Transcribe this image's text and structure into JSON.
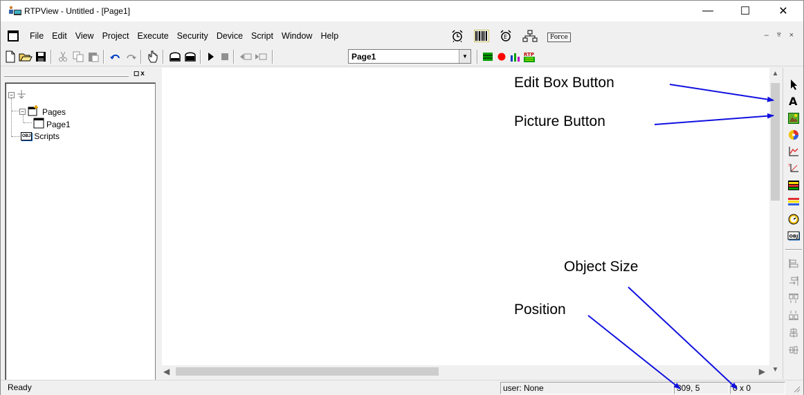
{
  "window": {
    "title": "RTPView  -  Untitled - [Page1]",
    "minimize_glyph": "—",
    "maximize_glyph": "☐",
    "close_glyph": "✕"
  },
  "menu": {
    "items": [
      "File",
      "Edit",
      "View",
      "Project",
      "Execute",
      "Security",
      "Device",
      "Script",
      "Window",
      "Help"
    ],
    "force_label": "Force",
    "mdi_minimize": "–",
    "mdi_restore": "ⱄ",
    "mdi_close": "×"
  },
  "toolbar": {
    "page_selector_value": "Page1"
  },
  "tree": {
    "header_buttons": "◻x",
    "root_expander": "−",
    "pages_expander": "−",
    "pages_label": "Pages",
    "page1_label": "Page1",
    "scripts_label": "Scripts",
    "obj_badge": "OBJ"
  },
  "statusbar": {
    "ready": "Ready",
    "user": "user: None",
    "position": "309, 5",
    "size": "0 x 0"
  },
  "annotations": {
    "edit_box_button": "Edit Box Button",
    "picture_button": "Picture Button",
    "object_size": "Object Size",
    "position": "Position"
  },
  "icons": {
    "toolbar": [
      "new-file-icon",
      "open-folder-icon",
      "save-icon",
      "cut-icon",
      "copy-icon",
      "paste-icon",
      "undo-icon",
      "redo-icon",
      "pointer-hand-icon",
      "upload-icon",
      "download-icon",
      "run-icon",
      "stop-icon",
      "prev-page-icon",
      "next-page-icon",
      "grid-icon",
      "record-icon",
      "bar-chart-icon",
      "rtp-logo-icon"
    ],
    "palette": [
      "select-arrow-icon",
      "text-icon",
      "picture-icon",
      "color-wheel-icon",
      "trend-chart-icon",
      "xy-plot-icon",
      "bar-meter-icon",
      "level-bars-icon",
      "gauge-icon",
      "object-icon",
      "align-left-icon",
      "align-right-icon",
      "align-top-icon",
      "align-bottom-icon",
      "center-horizontal-icon",
      "center-vertical-icon"
    ]
  },
  "colors": {
    "annotation_arrow": "#1010e0",
    "record_red": "#ff0000",
    "grid_green": "#00a000"
  }
}
